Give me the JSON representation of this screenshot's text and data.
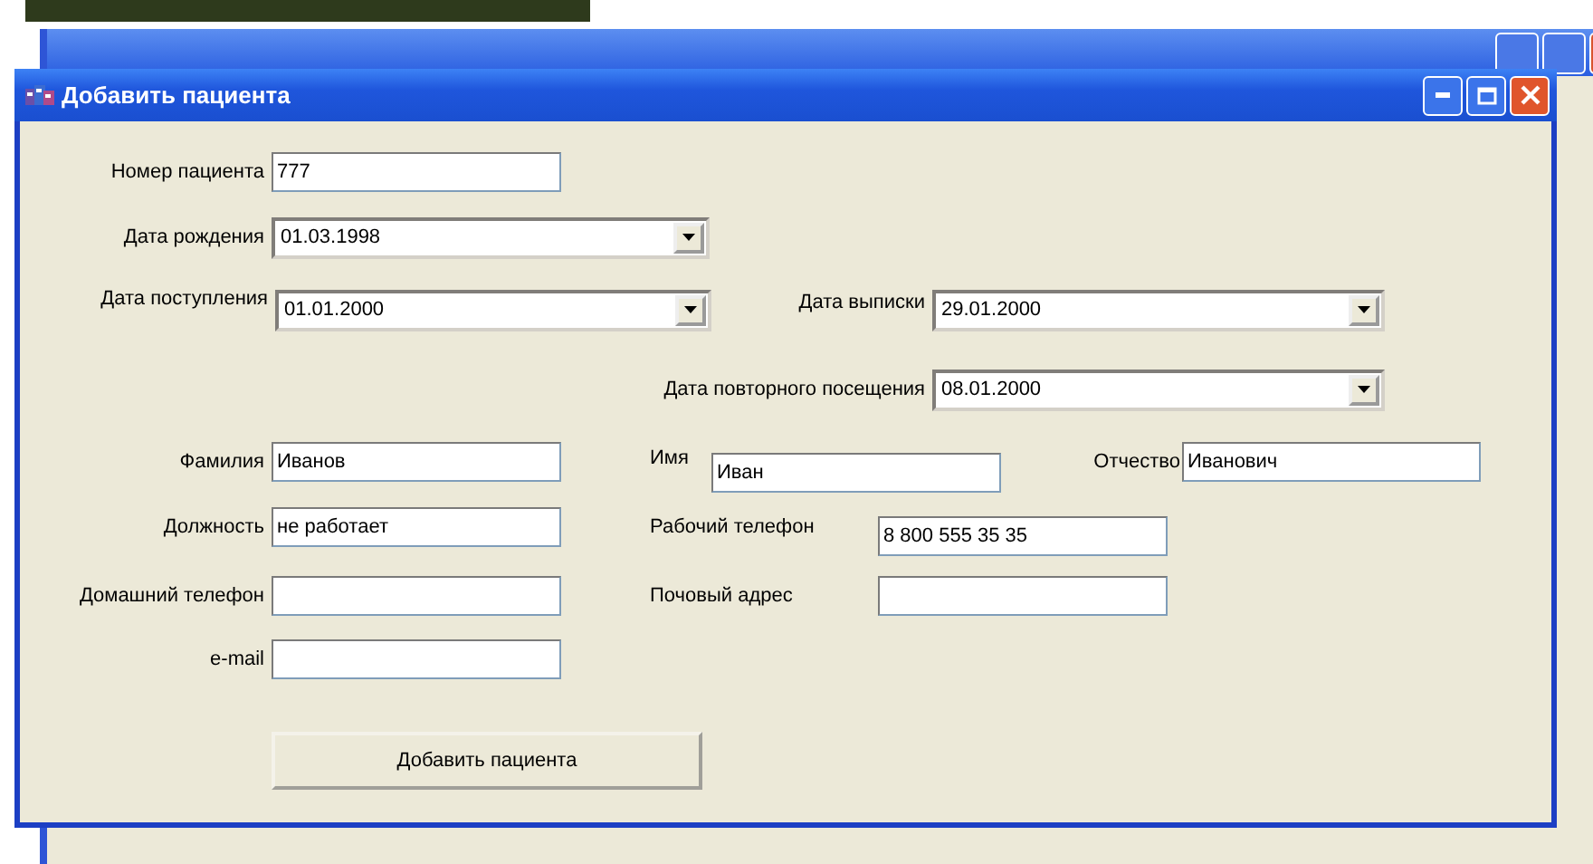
{
  "dialog": {
    "title": "Добавить пациента"
  },
  "rows": [
    [
      {
        "label": "Номер пациента",
        "value": "777",
        "kind": "text"
      }
    ],
    [
      {
        "label": "Дата рождения",
        "value": "01.03.1998",
        "kind": "date"
      }
    ],
    [
      {
        "label": "Дата поступления",
        "value": "01.01.2000",
        "kind": "date"
      },
      {
        "label": "Дата выписки",
        "value": "29.01.2000",
        "kind": "date"
      }
    ],
    [
      {
        "label": "Дата повторного посещения",
        "value": "08.01.2000",
        "kind": "date"
      }
    ],
    [
      {
        "label": "Фамилия",
        "value": "Иванов",
        "kind": "text"
      },
      {
        "label": "Имя",
        "value": "Иван",
        "kind": "text"
      },
      {
        "label": "Отчество",
        "value": "Иванович",
        "kind": "text"
      }
    ],
    [
      {
        "label": "Должность",
        "value": "не работает",
        "kind": "text"
      },
      {
        "label": "Рабочий телефон",
        "value": "8 800 555 35 35",
        "kind": "text"
      }
    ],
    [
      {
        "label": "Домашний телефон",
        "kind": "text"
      },
      {
        "label": "Почовый адрес",
        "kind": "text"
      }
    ],
    [
      {
        "label": "e-mail",
        "kind": "text"
      }
    ]
  ],
  "submit_button": "Добавить пациента"
}
